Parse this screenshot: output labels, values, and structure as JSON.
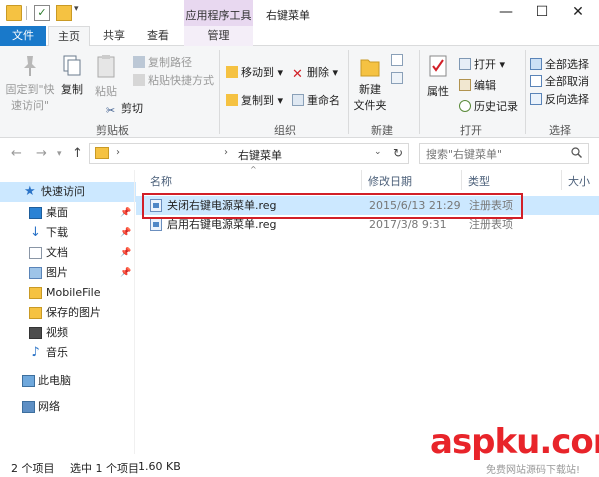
{
  "window": {
    "title": "右键菜单",
    "context_tab": "应用程序工具",
    "minimize": "—",
    "maximize": "☐",
    "close": "✕"
  },
  "tabs": [
    "文件",
    "主页",
    "共享",
    "查看",
    "管理"
  ],
  "ribbon": {
    "clipboard": {
      "group_label": "剪贴板",
      "pin_line1": "固定到\"快",
      "pin_line2": "速访问\"",
      "copy": "复制",
      "paste": "粘贴",
      "copy_path": "复制路径",
      "paste_shortcut": "粘贴快捷方式",
      "cut": "剪切"
    },
    "organize": {
      "group_label": "组织",
      "move_to": "移动到",
      "copy_to": "复制到",
      "delete": "删除",
      "rename": "重命名"
    },
    "new": {
      "group_label": "新建",
      "new_folder_line1": "新建",
      "new_folder_line2": "文件夹"
    },
    "open": {
      "group_label": "打开",
      "properties": "属性",
      "open": "打开",
      "edit": "编辑",
      "history": "历史记录"
    },
    "select": {
      "group_label": "选择",
      "select_all": "全部选择",
      "select_none": "全部取消",
      "invert": "反向选择"
    }
  },
  "address": {
    "path": "右键菜单",
    "search_placeholder": "搜索\"右键菜单\""
  },
  "nav_pane": {
    "items": [
      {
        "label": "快速访问",
        "icon": "star-icon",
        "pinned": false
      },
      {
        "label": "桌面",
        "icon": "desktop-icon",
        "pinned": true
      },
      {
        "label": "下载",
        "icon": "download-icon",
        "pinned": true
      },
      {
        "label": "文档",
        "icon": "document-icon",
        "pinned": true
      },
      {
        "label": "图片",
        "icon": "pictures-icon",
        "pinned": true
      },
      {
        "label": "MobileFile",
        "icon": "folder-icon",
        "pinned": false
      },
      {
        "label": "保存的图片",
        "icon": "folder-icon",
        "pinned": false
      },
      {
        "label": "视频",
        "icon": "video-icon",
        "pinned": false
      },
      {
        "label": "音乐",
        "icon": "music-icon",
        "pinned": false
      },
      {
        "label": "此电脑",
        "icon": "computer-icon",
        "pinned": false
      },
      {
        "label": "网络",
        "icon": "network-icon",
        "pinned": false
      }
    ]
  },
  "file_list": {
    "columns": [
      "名称",
      "修改日期",
      "类型",
      "大小"
    ],
    "rows": [
      {
        "name": "关闭右键电源菜单.reg",
        "date": "2015/6/13 21:29",
        "type": "注册表项"
      },
      {
        "name": "启用右键电源菜单.reg",
        "date": "2017/3/8 9:31",
        "type": "注册表项"
      }
    ]
  },
  "status": {
    "count": "2 个项目",
    "selected": "选中 1 个项目",
    "size": "1.60 KB"
  },
  "watermark": {
    "logo": "aspku.com",
    "sub": "免费网站源码下载站!"
  },
  "colors": {
    "file_tab": "#1979ca",
    "selection": "#cce8ff",
    "highlight_box": "#d21f27",
    "context_tab": "#e8d8f0",
    "watermark": "#e8242a"
  }
}
